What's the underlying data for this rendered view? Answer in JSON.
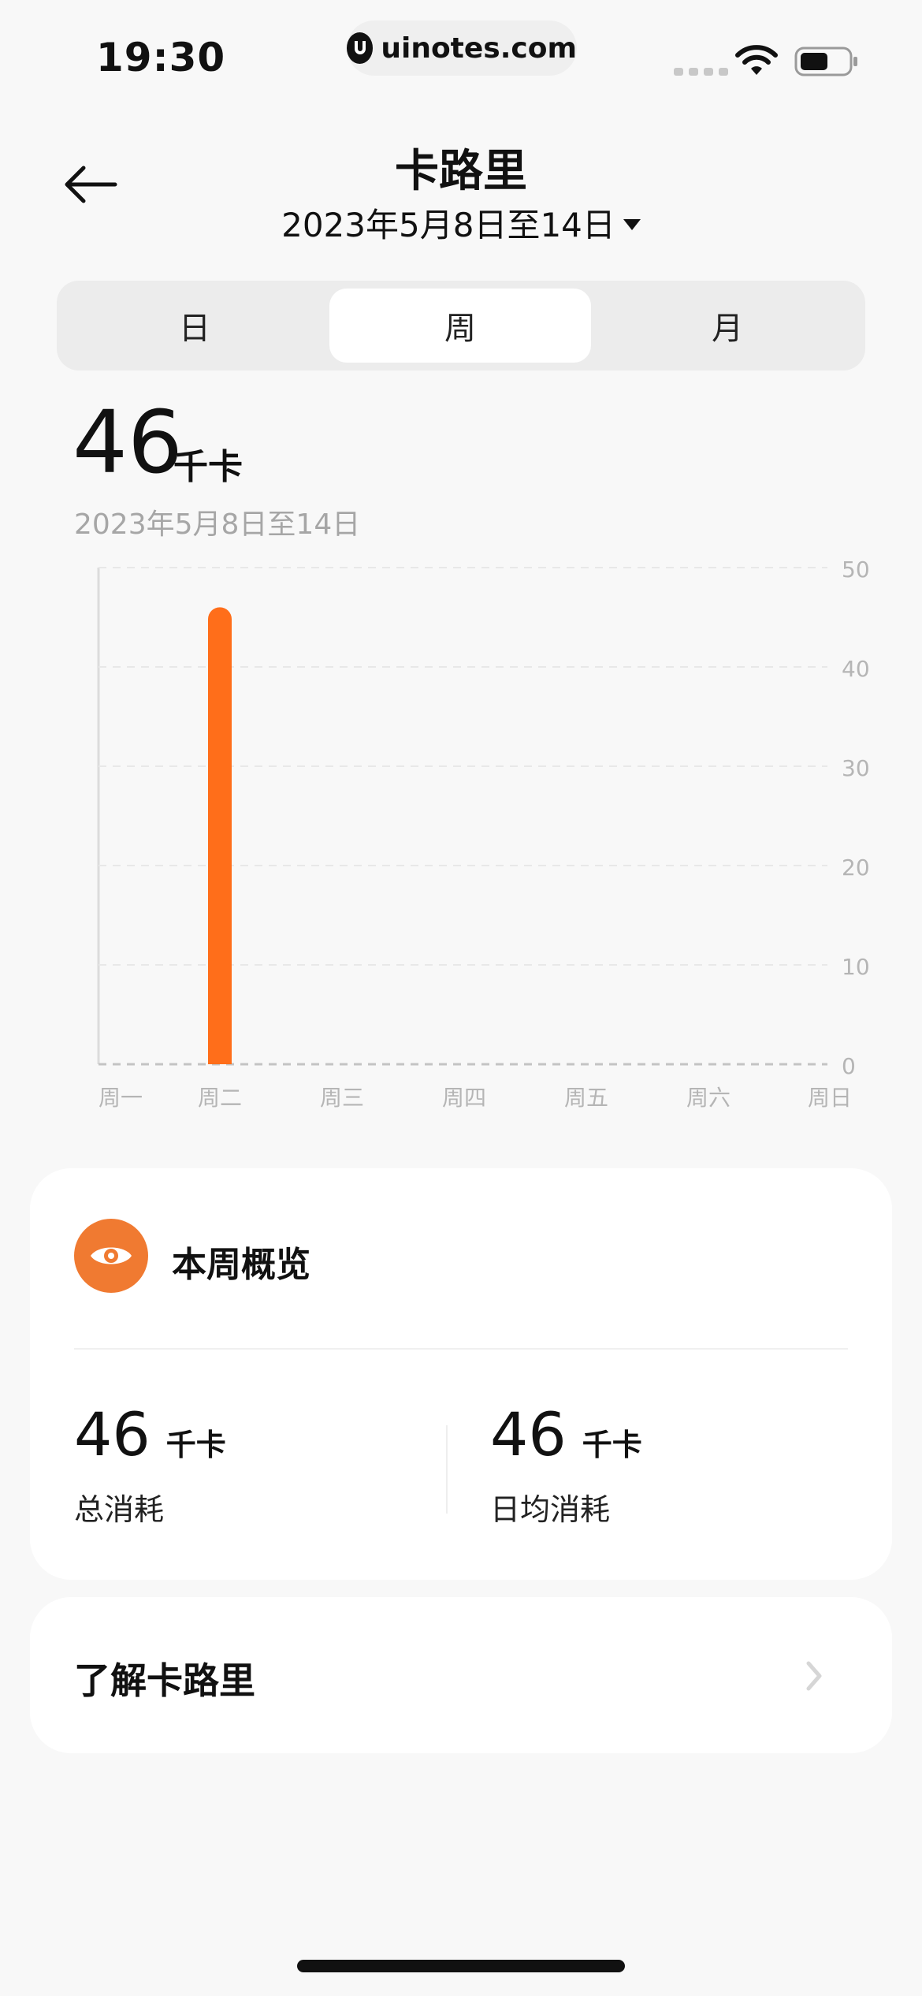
{
  "status_bar": {
    "time": "19:30",
    "site": "uinotes.com"
  },
  "header": {
    "title": "卡路里",
    "date_range": "2023年5月8日至14日"
  },
  "segments": [
    "日",
    "周",
    "月"
  ],
  "selected_segment": "周",
  "summary": {
    "value": "46",
    "unit": "千卡",
    "range": "2023年5月8日至14日"
  },
  "chart_data": {
    "type": "bar",
    "categories": [
      "周一",
      "周二",
      "周三",
      "周四",
      "周五",
      "周六",
      "周日"
    ],
    "values": [
      0,
      46,
      0,
      0,
      0,
      0,
      0
    ],
    "ylim": [
      0,
      50
    ],
    "yticks": [
      "50",
      "40",
      "30",
      "20",
      "10",
      "0"
    ],
    "bar_color": "#ff6e1a",
    "grid": true
  },
  "overview": {
    "title": "本周概览",
    "total": {
      "value": "46",
      "unit": "千卡",
      "label": "总消耗"
    },
    "daily_avg": {
      "value": "46",
      "unit": "千卡",
      "label": "日均消耗"
    }
  },
  "learn_more": {
    "label": "了解卡路里"
  },
  "colors": {
    "accent": "#f07a31",
    "bar": "#ff6e1a",
    "background": "#f8f8f8"
  }
}
